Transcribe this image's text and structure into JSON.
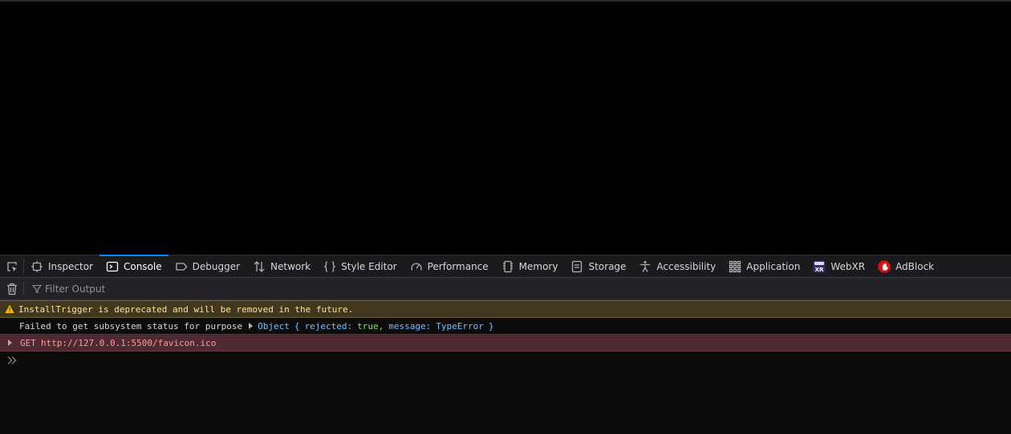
{
  "toolbar": {
    "tabs": [
      {
        "label": "Inspector",
        "icon": "inspector-icon"
      },
      {
        "label": "Console",
        "icon": "console-icon"
      },
      {
        "label": "Debugger",
        "icon": "debugger-icon"
      },
      {
        "label": "Network",
        "icon": "network-icon"
      },
      {
        "label": "Style Editor",
        "icon": "style-editor-icon"
      },
      {
        "label": "Performance",
        "icon": "performance-icon"
      },
      {
        "label": "Memory",
        "icon": "memory-icon"
      },
      {
        "label": "Storage",
        "icon": "storage-icon"
      },
      {
        "label": "Accessibility",
        "icon": "accessibility-icon"
      },
      {
        "label": "Application",
        "icon": "application-icon"
      },
      {
        "label": "WebXR",
        "icon": "webxr-icon"
      },
      {
        "label": "AdBlock",
        "icon": "adblock-icon"
      }
    ],
    "selected_tab": "Console",
    "accent_color": "#0a84ff"
  },
  "filter": {
    "placeholder": "Filter Output",
    "value": ""
  },
  "console": {
    "messages": [
      {
        "level": "warning",
        "text": "InstallTrigger is deprecated and will be removed in the future."
      },
      {
        "level": "log",
        "text": "Failed to get subsystem status for purpose",
        "object": {
          "label": "Object",
          "open": "{",
          "key1": "rejected:",
          "value1": "true,",
          "key2": "message:",
          "value2": "TypeError",
          "close": "}"
        }
      },
      {
        "level": "error",
        "method": "GET",
        "url": "http://127.0.0.1:5500/favicon.ico"
      }
    ],
    "prompt_icon": "double-chevron-right-icon"
  },
  "colors": {
    "warning_bg": "#42381f",
    "error_bg": "#4d2a31",
    "panel_bg": "#0c0c0d"
  }
}
